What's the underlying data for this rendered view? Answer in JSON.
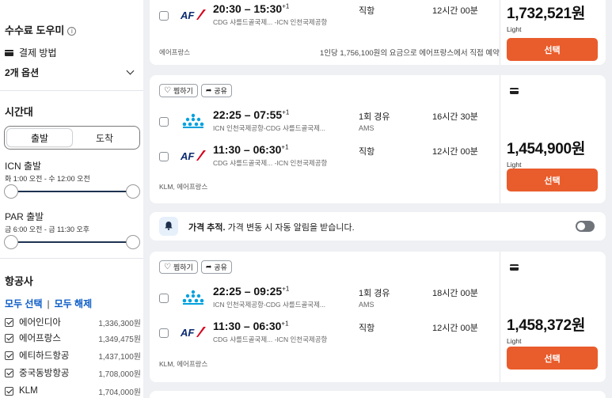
{
  "sidebar": {
    "fee_assistant": "수수료 도우미",
    "info_glyph": "i",
    "payment_method": "결제 방법",
    "payment_select": "2개 옵션",
    "time_heading": "시간대",
    "toggle": {
      "depart": "출발",
      "arrive": "도착"
    },
    "icn": {
      "label": "ICN 출발",
      "range": "화 1:00 오전 - 수 12:00 오전"
    },
    "par": {
      "label": "PAR 출발",
      "range": "금 6:00 오전 - 금 11:30 오후"
    },
    "airlines_heading": "항공사",
    "select_all": "모두 선택",
    "separator": "|",
    "clear_all": "모두 해제",
    "airlines": [
      {
        "name": "에어인디아",
        "price": "1,336,300원"
      },
      {
        "name": "에어프랑스",
        "price": "1,349,475원"
      },
      {
        "name": "에티하드항공",
        "price": "1,437,100원"
      },
      {
        "name": "중국동방항공",
        "price": "1,708,000원"
      },
      {
        "name": "KLM",
        "price": "1,704,000원"
      }
    ]
  },
  "results": [
    {
      "leg": {
        "times": "20:30 – 15:30",
        "plus": "+1",
        "route": "CDG 샤를드골국제... -ICN 인천국제공항",
        "stops": "직항",
        "via": "",
        "duration": "12시간 00분"
      },
      "operator": "에어프랑스",
      "note": "1인당 1,756,100원의 요금으로 에어프랑스에서 직접 예약",
      "price": "1,732,521원",
      "fare": "Light",
      "select": "선택"
    },
    {
      "chips": {
        "save": "찜하기",
        "share": "공유"
      },
      "legs": [
        {
          "times": "22:25 – 07:55",
          "plus": "+1",
          "route": "ICN 인천국제공항-CDG 샤를드골국제...",
          "stops": "1회 경유",
          "via": "AMS",
          "duration": "16시간 30분"
        },
        {
          "times": "11:30 – 06:30",
          "plus": "+1",
          "route": "CDG 샤를드골국제... -ICN 인천국제공항",
          "stops": "직항",
          "via": "",
          "duration": "12시간 00분"
        }
      ],
      "operator": "KLM, 에어프랑스",
      "price": "1,454,900원",
      "fare": "Light",
      "select": "선택"
    },
    {
      "chips": {
        "save": "찜하기",
        "share": "공유"
      },
      "legs": [
        {
          "times": "22:25 – 09:25",
          "plus": "+1",
          "route": "ICN 인천국제공항-CDG 샤를드골국제...",
          "stops": "1회 경유",
          "via": "AMS",
          "duration": "18시간 00분"
        },
        {
          "times": "11:30 – 06:30",
          "plus": "+1",
          "route": "CDG 샤를드골국제... -ICN 인천국제공항",
          "stops": "직항",
          "via": "",
          "duration": "12시간 00분"
        }
      ],
      "operator": "KLM, 에어프랑스",
      "price": "1,458,372원",
      "fare": "Light",
      "select": "선택"
    }
  ],
  "price_alert": {
    "bold": "가격 추적.",
    "text": " 가격 변동 시 자동 알림을 받습니다.",
    "enabled": false
  },
  "colors": {
    "accent": "#e95c2c",
    "link": "#0a5bc7",
    "slider": "#1e3250",
    "af_red": "#d6001c",
    "af_navy": "#0b2a6f",
    "klm_blue": "#00a1de"
  }
}
